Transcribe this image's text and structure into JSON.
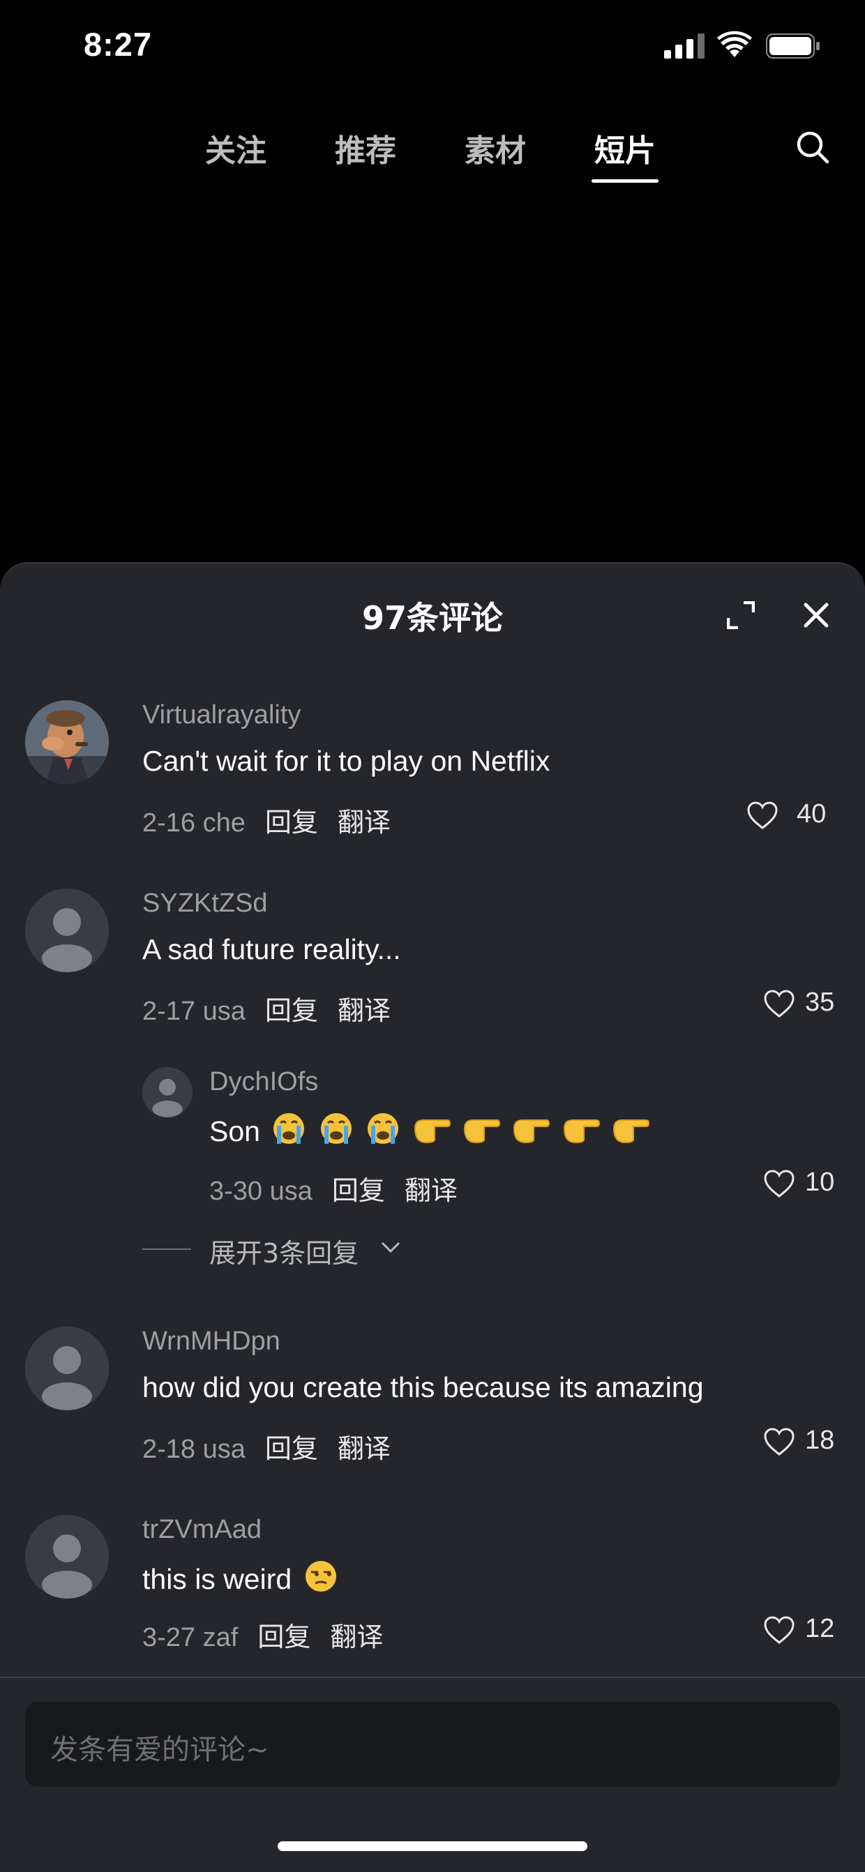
{
  "status_bar": {
    "time": "8:27"
  },
  "nav": {
    "tabs": [
      {
        "label": "关注"
      },
      {
        "label": "推荐"
      },
      {
        "label": "素材"
      },
      {
        "label": "短片",
        "active": true
      }
    ]
  },
  "panel": {
    "title": "97条评论"
  },
  "comments": [
    {
      "user": "Virtualrayality",
      "text": "Can't wait for it to play on Netflix",
      "date": "2-16 che",
      "reply": "回复",
      "translate": "翻译",
      "likes": "40"
    },
    {
      "user": "SYZKtZSd",
      "text": "A sad future reality...",
      "date": "2-17 usa",
      "reply": "回复",
      "translate": "翻译",
      "likes": "35"
    },
    {
      "user": "DychIOfs",
      "text": "Son",
      "date": "3-30 usa",
      "reply": "回复",
      "translate": "翻译",
      "likes": "10"
    },
    {
      "user": "WrnMHDpn",
      "text": "how did you create this because its amazing",
      "date": "2-18 usa",
      "reply": "回复",
      "translate": "翻译",
      "likes": "18"
    },
    {
      "user": "trZVmAad",
      "text": "this is weird",
      "date": "3-27 zaf",
      "reply": "回复",
      "translate": "翻译",
      "likes": "12"
    }
  ],
  "expand_replies": "展开3条回复",
  "input": {
    "placeholder": "发条有爱的评论~"
  },
  "colors": {
    "panel_bg": "#25262b",
    "muted": "#9e9fa3",
    "input_bg": "#18191c"
  }
}
